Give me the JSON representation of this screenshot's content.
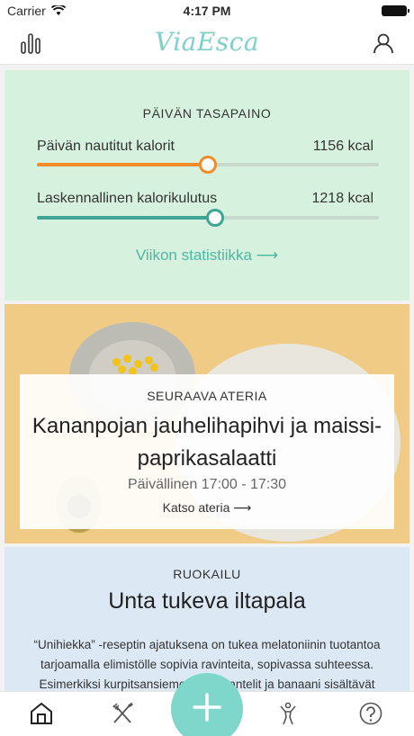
{
  "status_bar": {
    "carrier": "Carrier",
    "time": "4:17 PM"
  },
  "nav": {
    "logo": "ViaEsca",
    "left_icon": "bar-chart-icon",
    "right_icon": "user-icon"
  },
  "balance": {
    "heading": "PÄIVÄN TASAPAINO",
    "rows": [
      {
        "label": "Päivän nautitut kalorit",
        "value": "1156 kcal",
        "level": 0.5,
        "color": "#f28c28"
      },
      {
        "label": "Laskennallinen kalorikulutus",
        "value": "1218 kcal",
        "level": 0.52,
        "color": "#3ea594"
      }
    ],
    "link": "Viikon statistiikka ⟶"
  },
  "meal": {
    "label": "SEURAAVA ATERIA",
    "title": "Kananpojan jauhelihapihvi ja maissi-paprikasalaatti",
    "time": "Päivällinen 17:00 - 17:30",
    "link": "Katso ateria ⟶"
  },
  "food": {
    "label": "RUOKAILU",
    "title": "Unta tukeva iltapala",
    "body": "“Unihiekka” -reseptin ajatuksena on tukea melatoniinin tuotantoa tarjoamalla elimistölle sopivia ravinteita, sopivassa suhteessa. Esimerkiksi kurpitsansiemenet ja mantelit ja banaani sisältävät"
  },
  "tabs": [
    {
      "icon": "home-icon",
      "active": true
    },
    {
      "icon": "fork-knife-icon",
      "active": false
    },
    {
      "icon": "add-icon",
      "active": false
    },
    {
      "icon": "exercise-icon",
      "active": false
    },
    {
      "icon": "help-icon",
      "active": false
    }
  ],
  "colors": {
    "accent": "#7fd6ca",
    "balance_bg": "#d6f2de",
    "food_bg": "#dce9f5",
    "link": "#4cb7a5"
  }
}
